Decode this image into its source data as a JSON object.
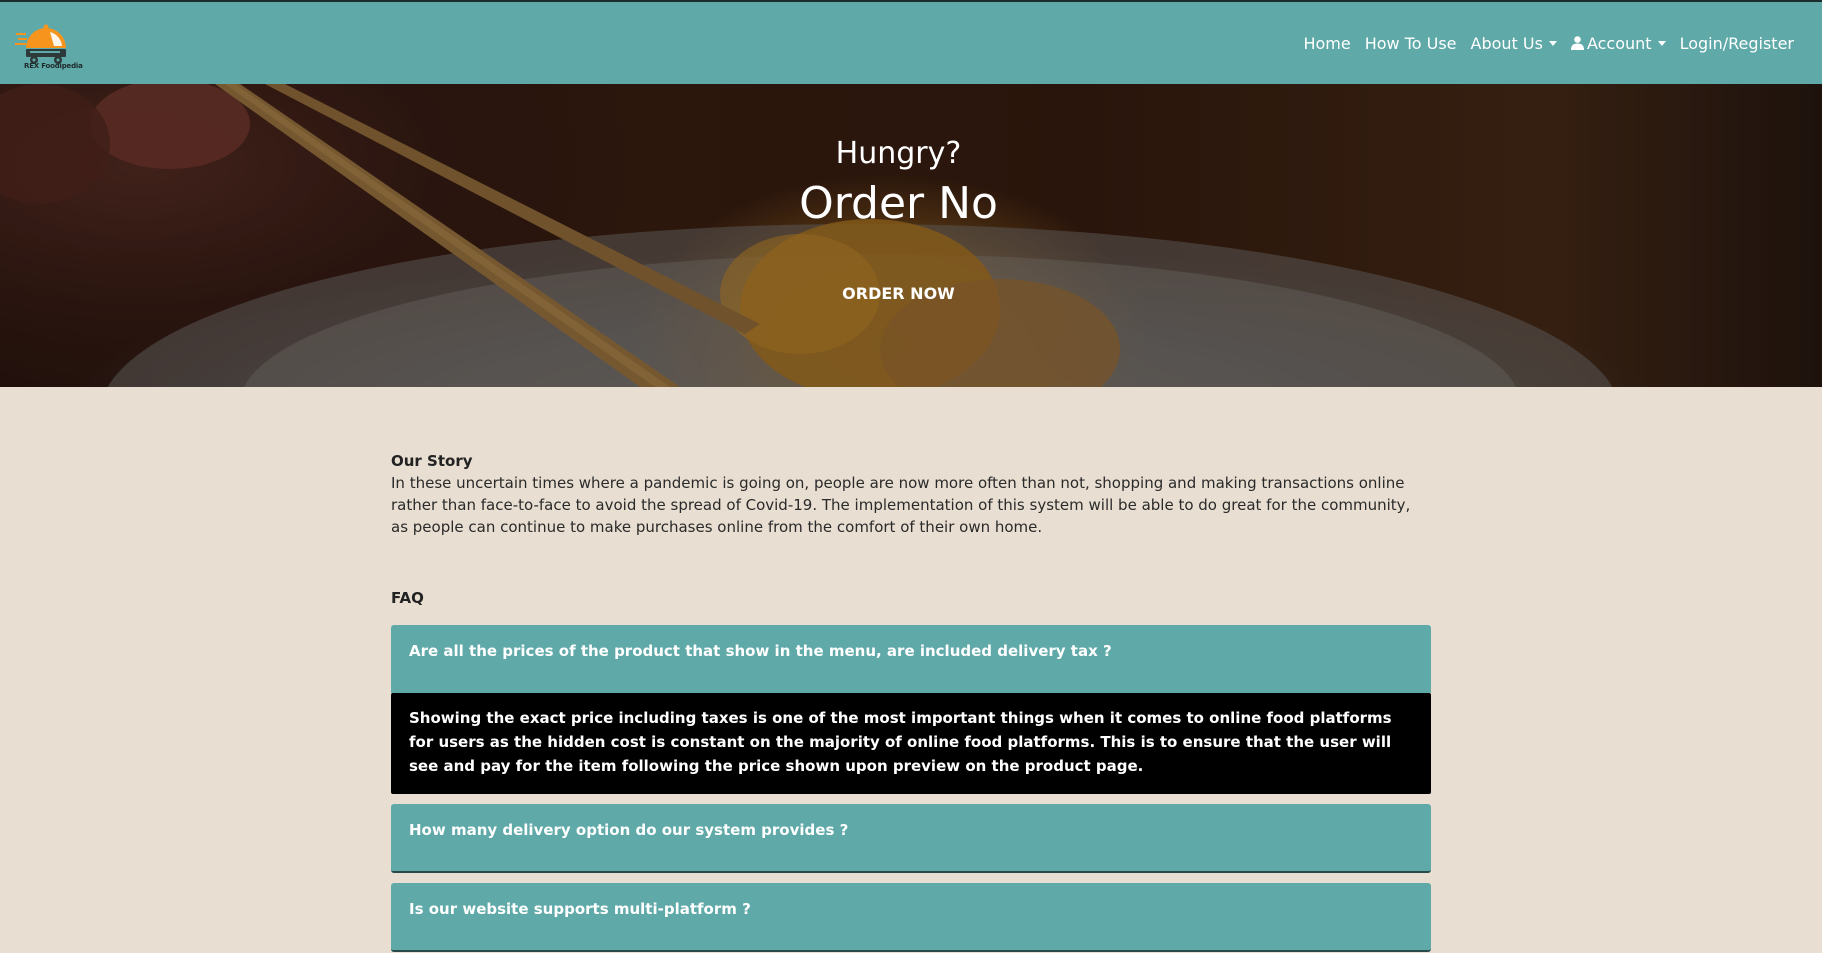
{
  "brand": {
    "logo_text": "REX Foodipedia",
    "colors": {
      "navbar": "#5fa9a8",
      "logo_orange": "#f7941d",
      "page_bg": "#e8ded1"
    }
  },
  "nav": {
    "home": "Home",
    "how_to_use": "How To Use",
    "about_us": "About Us",
    "account": "Account",
    "login_register": "Login/Register"
  },
  "hero": {
    "subtitle": "Hungry?",
    "title": "Order No",
    "button": "ORDER NOW"
  },
  "story": {
    "heading": "Our Story",
    "text": "In these uncertain times where a pandemic is going on, people are now more often than not, shopping and making transactions online rather than face-to-face to avoid the spread of Covid-19. The implementation of this system will be able to do great for the community, as people can continue to make purchases online from the comfort of their own home."
  },
  "faq": {
    "heading": "FAQ",
    "items": [
      {
        "question": "Are all the prices of the product that show in the menu, are included delivery tax ?",
        "answer": "Showing the exact price including taxes is one of the most important things when it comes to online food platforms for users as the hidden cost is constant on the majority of online food platforms. This is to ensure that the user will see and pay for the item following the price shown upon preview on the product page."
      },
      {
        "question": "How many delivery option do our system provides ?"
      },
      {
        "question": "Is our website supports multi-platform ?"
      }
    ]
  }
}
